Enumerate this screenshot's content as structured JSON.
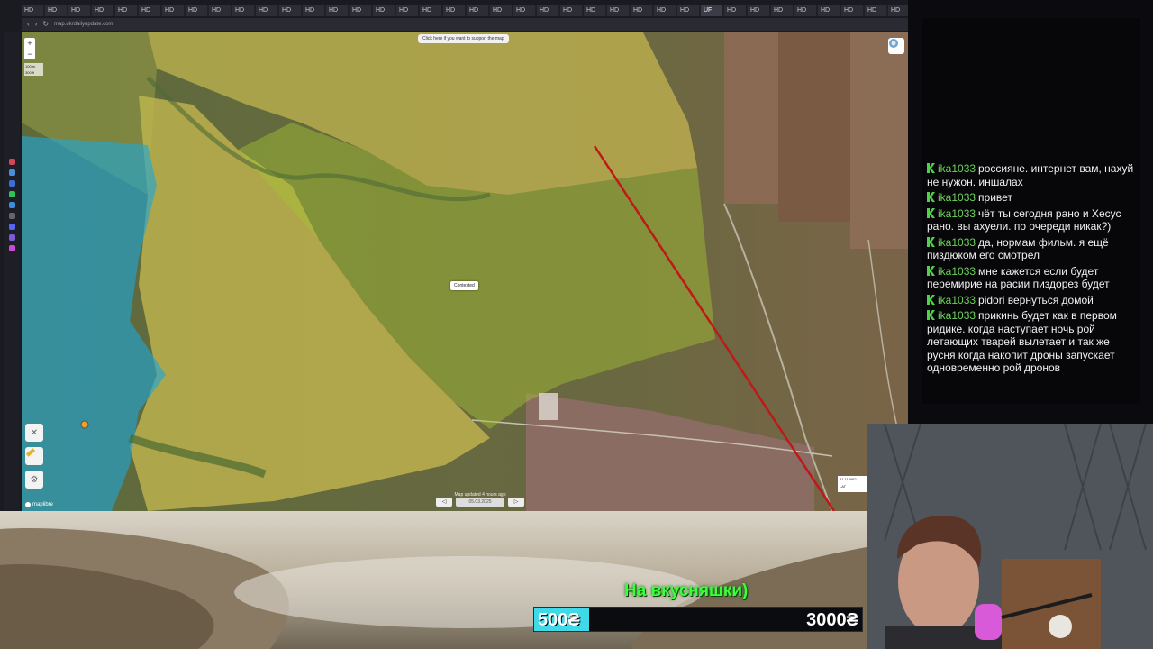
{
  "browser": {
    "tabs": [
      "HD",
      "HD",
      "HD",
      "HD",
      "HD",
      "HD",
      "HD",
      "HD",
      "HD",
      "HD",
      "HD",
      "HD",
      "HD",
      "HD",
      "HD",
      "HD",
      "HD",
      "HD",
      "HD",
      "HD",
      "HD",
      "HD",
      "HD",
      "HD",
      "HD",
      "HD",
      "HD",
      "HD",
      "HD",
      "HD",
      "HD",
      "HD",
      "HD",
      "HD",
      "HD",
      "HD",
      "HD",
      "HD",
      "HD",
      "HD",
      "HD"
    ],
    "active_tab": "UF",
    "url": "map.ukrdailyupdate.com"
  },
  "map": {
    "support_banner": "Click here if you want to support the map",
    "zoom_in": "+",
    "zoom_out": "−",
    "scale_lines": [
      "100 m",
      "300 ft"
    ],
    "contested_label": "Contested",
    "date_caption": "Map updated 4 hours ago",
    "date_value": "05.03.2025",
    "prev_label": "◁",
    "next_label": "▷",
    "coords_lines": [
      "51.115062",
      "LAT"
    ],
    "attribution": "maplibre",
    "colors": {
      "russian_zone": "#e3cf55",
      "contested": "#a7c432",
      "ukraine_zone": "#1fa6d6",
      "front_line": "#c01818"
    }
  },
  "chat": {
    "messages": [
      {
        "user": "ika1033",
        "text": "россияне. интернет вам, нахуй не нужон. иншалах"
      },
      {
        "user": "ika1033",
        "text": "привет"
      },
      {
        "user": "ika1033",
        "text": "чёт ты сегодня рано и Хесус рано. вы ахуели. по очереди никак?)"
      },
      {
        "user": "ika1033",
        "text": "да, нормам фильм. я ещё пиздюком его смотрел"
      },
      {
        "user": "ika1033",
        "text": "мне кажется если будет перемирие на расии пиздорез будет"
      },
      {
        "user": "ika1033",
        "text": "pidori вернуться домой"
      },
      {
        "user": "ika1033",
        "text": "прикинь будет как в первом ридике. когда наступает ночь рой летающих тварей вылетает и так же русня когда накопит дроны запускает одновременно рой дронов"
      }
    ],
    "colors": {
      "username": "#6bd35a",
      "badge": "#4fd14a"
    }
  },
  "donation": {
    "title": "На вкусняшки)",
    "current": "500₴",
    "goal": "3000₴",
    "progress_fraction": 0.167,
    "colors": {
      "title": "#3bff3b",
      "fill": "#3fd9e8"
    }
  }
}
